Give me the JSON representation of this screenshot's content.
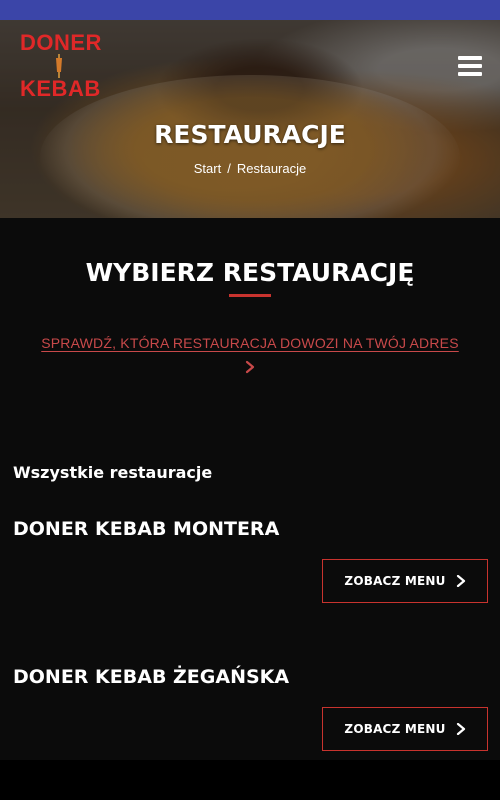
{
  "header": {
    "logo_top": "DONER",
    "logo_bottom": "KEBAB",
    "menu_icon": "hamburger-menu-icon",
    "title": "RESTAURACJE",
    "breadcrumb": {
      "home": "Start",
      "separator": "/",
      "current": "Restauracje"
    }
  },
  "main": {
    "title": "WYBIERZ RESTAURACJĘ",
    "check_link": "SPRAWDŹ, KTÓRA RESTAURACJA DOWOZI NA TWÓJ ADRES",
    "chevron_icon": "chevron-right-icon",
    "all_label": "Wszystkie restauracje",
    "restaurants": [
      {
        "name": "DONER KEBAB MONTERA",
        "button_label": "ZOBACZ MENU"
      },
      {
        "name": "DONER KEBAB ŻEGAŃSKA",
        "button_label": "ZOBACZ MENU"
      }
    ]
  },
  "colors": {
    "status_bar": "#3b45a8",
    "accent_red": "#c8332e",
    "logo_red": "#e02828",
    "link_red": "#c8494a",
    "background": "#0b0b0b"
  }
}
